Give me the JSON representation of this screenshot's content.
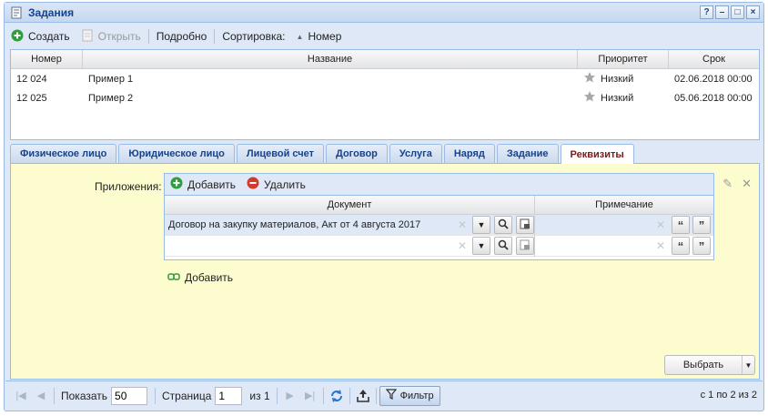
{
  "window": {
    "title": "Задания"
  },
  "title_tools": [
    "?",
    "–",
    "□",
    "×"
  ],
  "toolbar": {
    "create_label": "Создать",
    "open_label": "Открыть",
    "detail_label": "Подробно",
    "sort_label": "Сортировка:",
    "sort_field": "Номер"
  },
  "grid": {
    "columns": [
      "Номер",
      "Название",
      "Приоритет",
      "Срок"
    ],
    "rows": [
      {
        "number": "12 024",
        "name": "Пример 1",
        "priority": "Низкий",
        "due": "02.06.2018 00:00"
      },
      {
        "number": "12 025",
        "name": "Пример 2",
        "priority": "Низкий",
        "due": "05.06.2018 00:00"
      }
    ]
  },
  "tabs": [
    "Физическое лицо",
    "Юридическое лицо",
    "Лицевой счет",
    "Договор",
    "Услуга",
    "Наряд",
    "Задание",
    "Реквизиты"
  ],
  "active_tab_index": 7,
  "attachments": {
    "label": "Приложения:",
    "add_label": "Добавить",
    "delete_label": "Удалить",
    "columns": [
      "Документ",
      "Примечание"
    ],
    "rows": [
      {
        "document": "Договор на закупку материалов, Акт от 4 августа 2017",
        "note": ""
      },
      {
        "document": "",
        "note": ""
      }
    ],
    "add_link_label": "Добавить"
  },
  "choose_button": "Выбрать",
  "pager": {
    "show_label": "Показать",
    "page_size": "50",
    "page_label": "Страница",
    "page_value": "1",
    "of_label": "из 1",
    "filter_label": "Фильтр",
    "info": "с 1 по 2 из 2"
  },
  "colors": {
    "accent": "#15428b",
    "panel_bg": "#fcfccf",
    "active_tab_text": "#7a1a1a"
  }
}
